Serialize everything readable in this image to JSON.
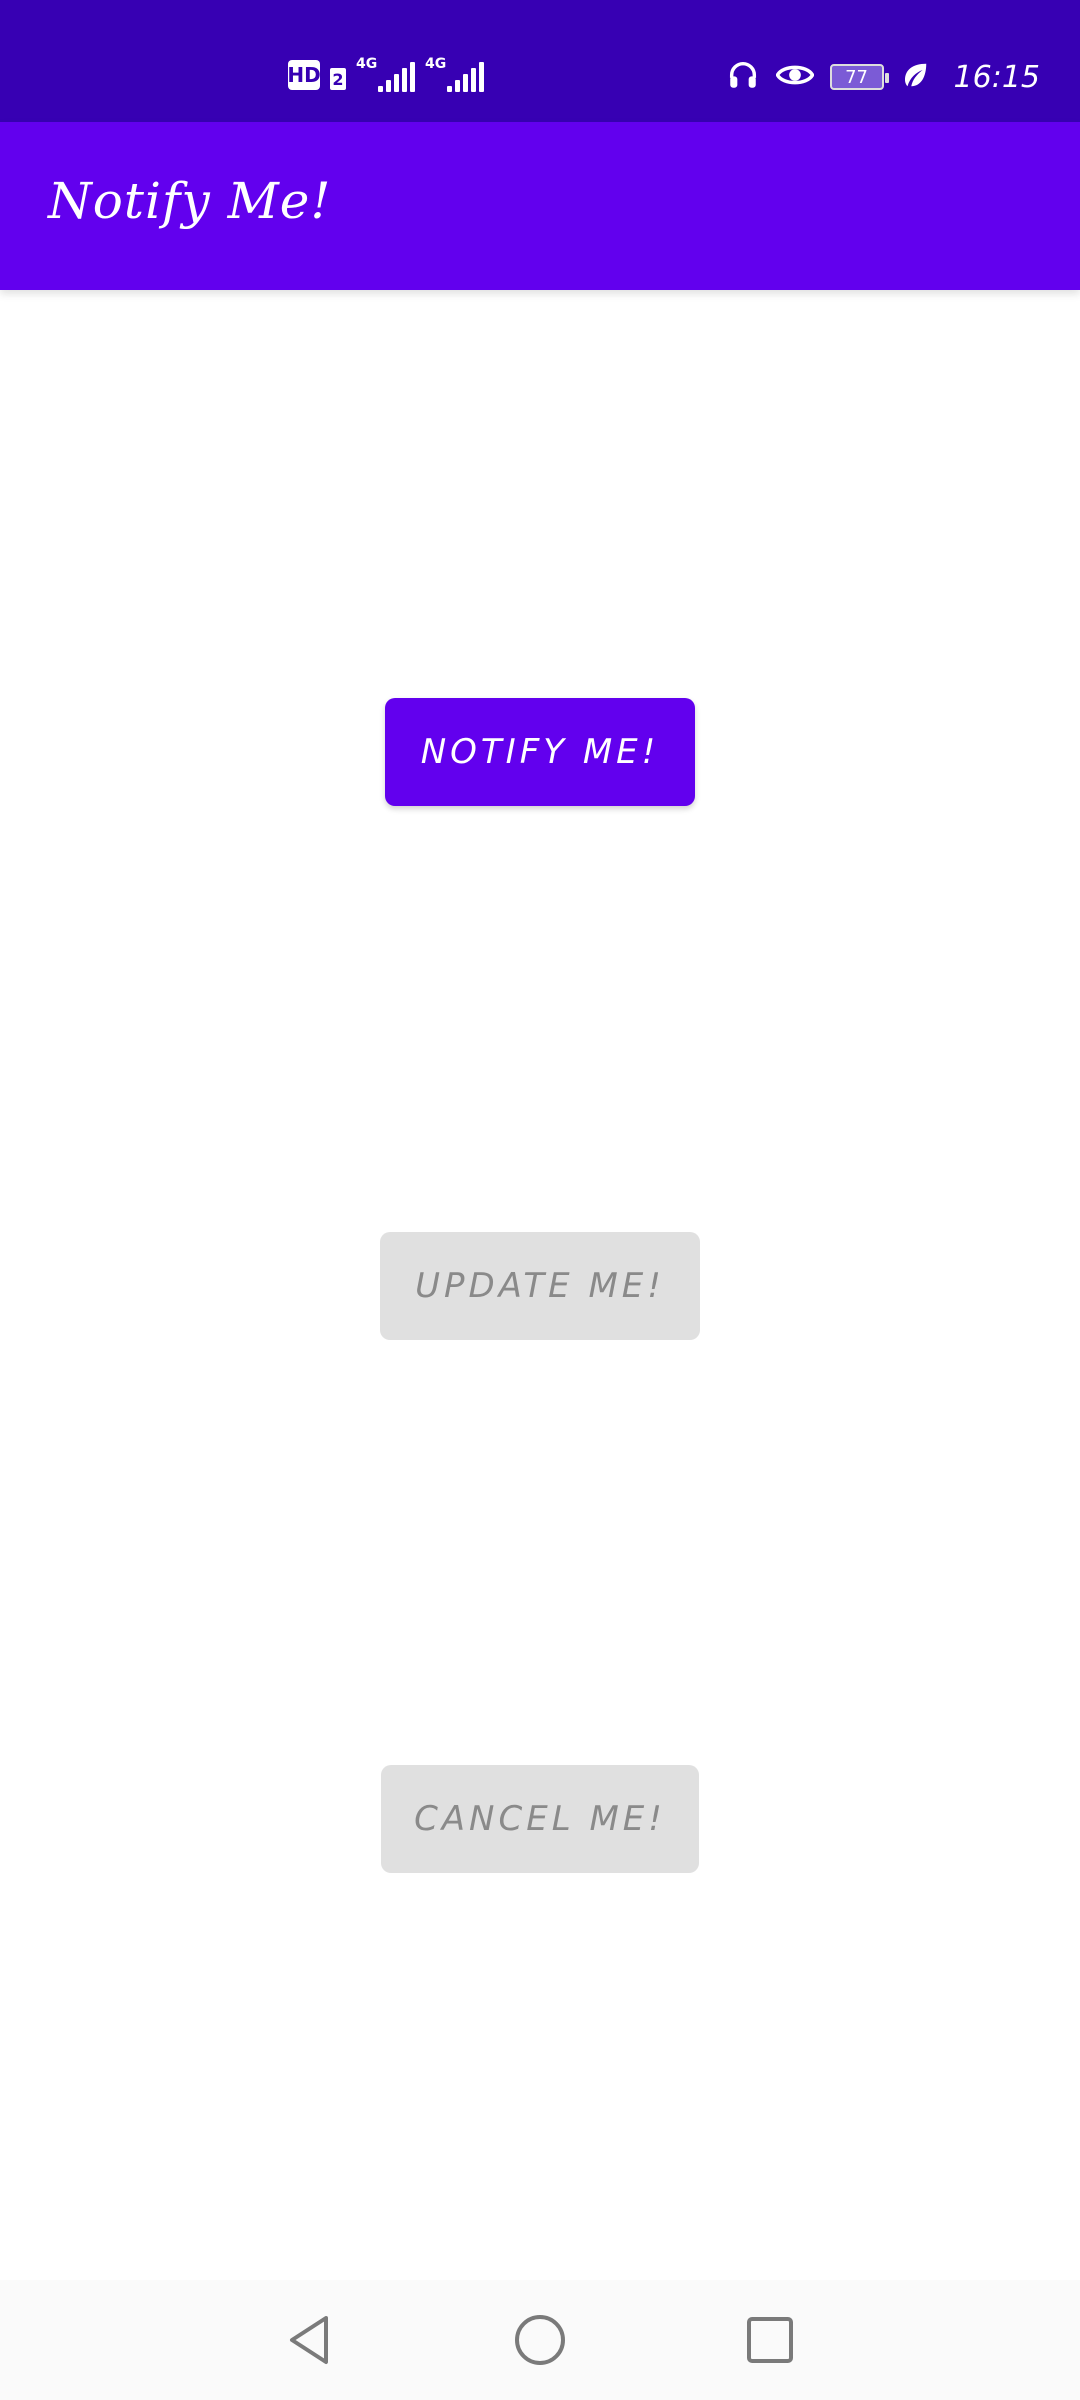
{
  "status_bar": {
    "hd_label": "HD",
    "sim_label": "2",
    "signal_1_label": "4G",
    "signal_2_label": "4G",
    "battery_level": "77",
    "time": "16:15"
  },
  "app_bar": {
    "title": "Notify Me!"
  },
  "buttons": {
    "notify_label": "NOTIFY ME!",
    "update_label": "UPDATE ME!",
    "cancel_label": "CANCEL ME!"
  },
  "colors": {
    "status_bar": "#3700B3",
    "app_bar": "#6200EE",
    "primary_button": "#6200EE",
    "disabled_button": "#E0E0E0",
    "disabled_text": "#8A8A8A"
  },
  "icons": {
    "nav_back": "back-triangle-icon",
    "nav_home": "home-circle-icon",
    "nav_recents": "recents-square-icon",
    "status": [
      "hd-icon",
      "signal-icon",
      "headphones-icon",
      "eye-icon",
      "battery-icon",
      "leaf-icon"
    ]
  }
}
